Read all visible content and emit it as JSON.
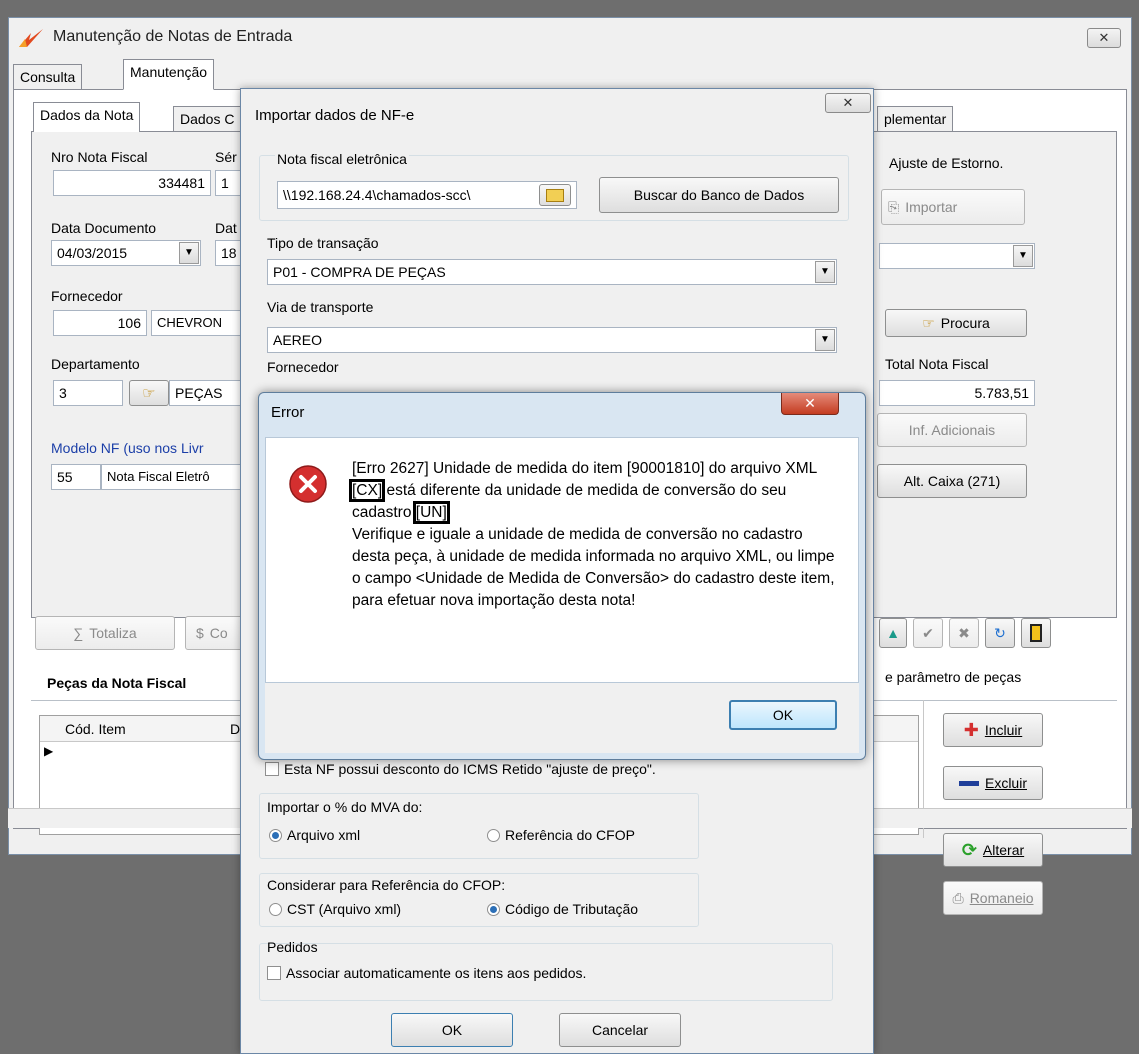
{
  "main_window": {
    "title": "Manutenção de Notas de Entrada",
    "close_glyph": "✕",
    "outer_tabs": [
      "Consulta",
      "Manutenção"
    ],
    "inner_tabs": [
      "Dados da Nota",
      "Dados C",
      "plementar"
    ],
    "nro_nota_label": "Nro Nota Fiscal",
    "nro_nota_value": "334481",
    "serie_label": "Sér",
    "serie_value": "1",
    "ajuste_label": "Ajuste  de Estorno.",
    "importar_label": "Importar",
    "data_doc_label": "Data Documento",
    "data_doc_value": "04/03/2015",
    "dat2_label": "Dat",
    "dat2_value": "18",
    "fornecedor_label": "Fornecedor",
    "fornecedor_code": "106",
    "fornecedor_name": "CHEVRON",
    "procura_label": "Procura",
    "departamento_label": "Departamento",
    "departamento_code": "3",
    "departamento_name": "PEÇAS",
    "total_label": "Total Nota Fiscal",
    "total_value": "5.783,51",
    "inf_adicionais_label": "Inf. Adicionais",
    "modelo_label": "Modelo NF (uso nos Livr",
    "modelo_code": "55",
    "modelo_name": "Nota Fiscal Eletrô",
    "alt_caixa_label": "Alt. Caixa (271)",
    "totaliza_label": "Totaliza",
    "c_label": "Co",
    "parametro_label": "e parâmetro de peças",
    "pecas_title": "Peças da Nota Fiscal",
    "grid_col_cod": "Cód. Item",
    "grid_col_d": "D",
    "incluir_label": "Incluir",
    "excluir_label": "Excluir",
    "alterar_label": "Alterar",
    "romaneio_label": "Romaneio"
  },
  "import_dialog": {
    "title": "Importar dados de NF-e",
    "close_glyph": "✕",
    "nfe_group_label": "Nota fiscal eletrônica",
    "nfe_path": "\\\\192.168.24.4\\chamados-scc\\",
    "buscar_label": "Buscar do Banco de Dados",
    "tipo_label": "Tipo de transação",
    "tipo_value": "P01 - COMPRA DE PEÇAS",
    "via_label": "Via de transporte",
    "via_value": "AEREO",
    "fornecedor_label": "Fornecedor",
    "desconto_label": "Esta NF possui desconto do ICMS Retido \"ajuste de preço\".",
    "mva_label": "Importar o % do MVA do:",
    "mva_opt1": "Arquivo xml",
    "mva_opt2": "Referência do CFOP",
    "cfop_label": "Considerar para Referência do CFOP:",
    "cfop_opt1": "CST (Arquivo xml)",
    "cfop_opt2": "Código de Tributação",
    "pedidos_label": "Pedidos",
    "pedidos_check": "Associar automaticamente os itens aos pedidos.",
    "ok_label": "OK",
    "cancel_label": "Cancelar"
  },
  "error_dialog": {
    "title": "Error",
    "close_glyph": "✕",
    "msg_part1": "[Erro 2627] Unidade de medida do item [90001810] do arquivo XML ",
    "msg_cx": "[CX]",
    "msg_part2": " está diferente da unidade de medida de conversão do seu cadastro ",
    "msg_un": "[UN]",
    "msg_part3": "Verifique e iguale a unidade de medida de conversão no cadastro desta peça, à unidade de medida informada no arquivo XML, ou limpe o campo <Unidade de Medida de Conversão> do cadastro deste item, para efetuar nova importação desta nota!",
    "ok_label": "OK"
  },
  "colors": {
    "error_red": "#d42f2f",
    "link_blue": "#1c3fa8",
    "dialog_border": "#6b87a6"
  }
}
